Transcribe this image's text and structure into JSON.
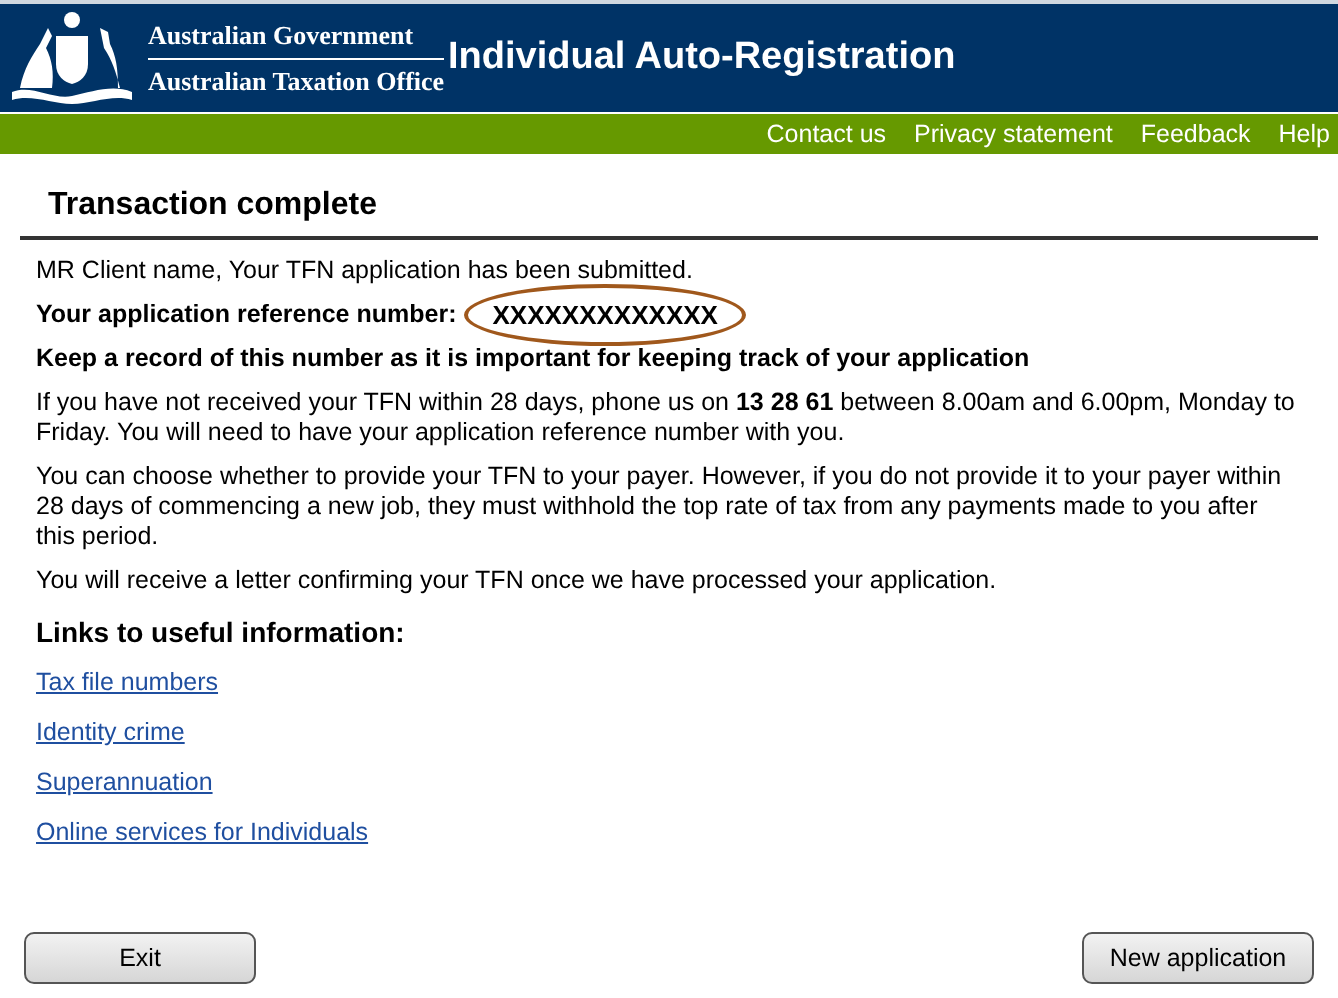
{
  "header": {
    "agency_line_1": "Australian Government",
    "agency_line_2": "Australian Taxation Office",
    "title": "Individual Auto-Registration"
  },
  "nav_links": [
    "Contact us",
    "Privacy statement",
    "Feedback",
    "Help"
  ],
  "page_title": "Transaction complete",
  "greeting": "MR Client name, Your TFN application has been submitted.",
  "reference": {
    "label": "Your application reference number:",
    "value": "XXXXXXXXXXXXX"
  },
  "record_note": "Keep a record of this number as it is important for keeping track of your application",
  "paragraphs": [
    "If you have not received your TFN within 28 days, phone us on **13 28 61** between 8.00am and 6.00pm, Monday to Friday. You will need to have your application reference number with you.",
    "You can choose whether to provide your TFN to your payer. However, if you do not provide it to your payer within 28 days of commencing a new job, they must withhold the top rate of tax from any payments made to you after this period.",
    "You will receive a letter confirming your TFN once we have processed your application."
  ],
  "links_heading": "Links to useful information:",
  "links": [
    "Tax file numbers",
    "Identity crime",
    "Superannuation",
    "Online services for Individuals"
  ],
  "buttons": [
    "Exit",
    "New application"
  ]
}
